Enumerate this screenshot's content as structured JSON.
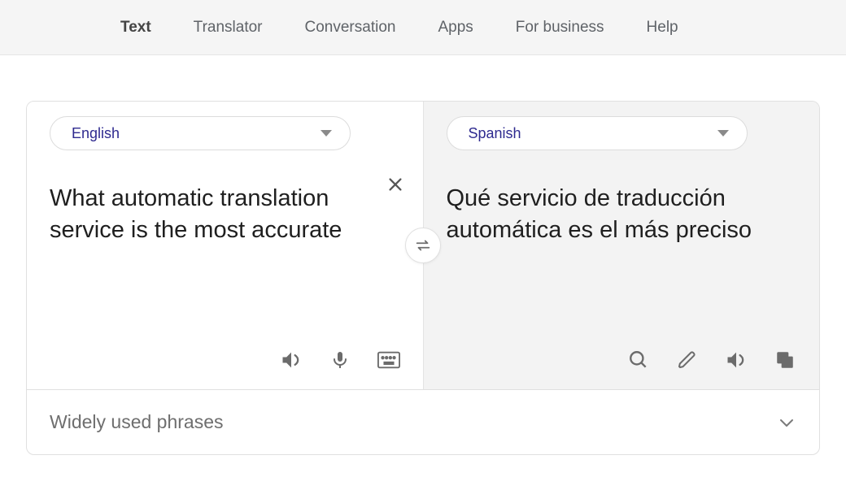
{
  "nav": {
    "items": [
      {
        "label": "Text",
        "active": true
      },
      {
        "label": "Translator",
        "active": false
      },
      {
        "label": "Conversation",
        "active": false
      },
      {
        "label": "Apps",
        "active": false
      },
      {
        "label": "For business",
        "active": false
      },
      {
        "label": "Help",
        "active": false
      }
    ]
  },
  "source": {
    "language": "English",
    "text": "What automatic translation service is the most accurate"
  },
  "target": {
    "language": "Spanish",
    "text": "Qué servicio de traducción automática es el más preciso"
  },
  "phrases": {
    "label": "Widely used phrases"
  }
}
